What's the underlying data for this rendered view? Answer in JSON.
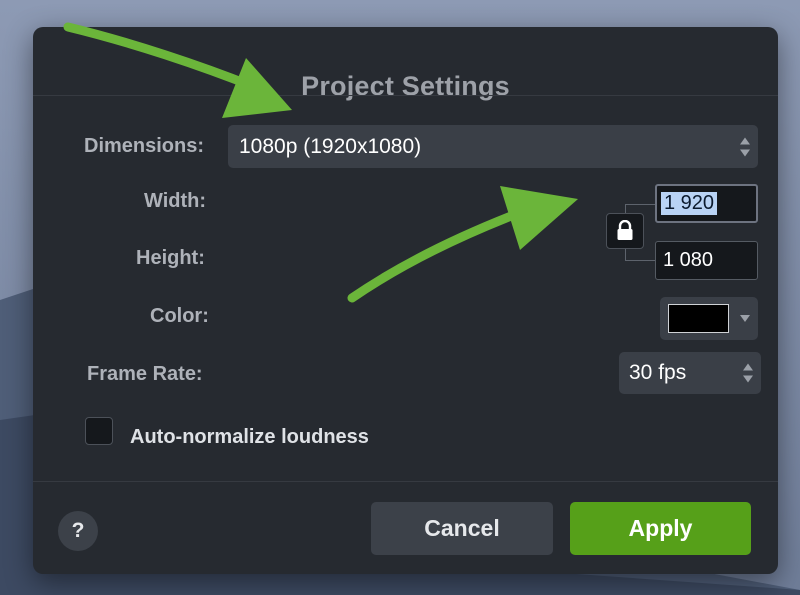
{
  "dialog": {
    "title": "Project Settings",
    "dimensions": {
      "label": "Dimensions:",
      "value": "1080p (1920x1080)"
    },
    "width": {
      "label": "Width:",
      "value": "1 920"
    },
    "height": {
      "label": "Height:",
      "value": "1 080"
    },
    "color": {
      "label": "Color:",
      "value": "#000000"
    },
    "frame_rate": {
      "label": "Frame Rate:",
      "value": "30 fps"
    },
    "auto_normalize": {
      "label": "Auto-normalize loudness",
      "checked": false
    },
    "help_label": "?",
    "cancel_label": "Cancel",
    "apply_label": "Apply"
  },
  "colors": {
    "dialog_bg": "#262a30",
    "apply_green": "#56a019",
    "annotation_arrow": "#6bb53a"
  },
  "icons": [
    "lock-icon",
    "stepper-up-icon",
    "stepper-down-icon",
    "dropdown-caret-icon",
    "annotation-arrow"
  ]
}
